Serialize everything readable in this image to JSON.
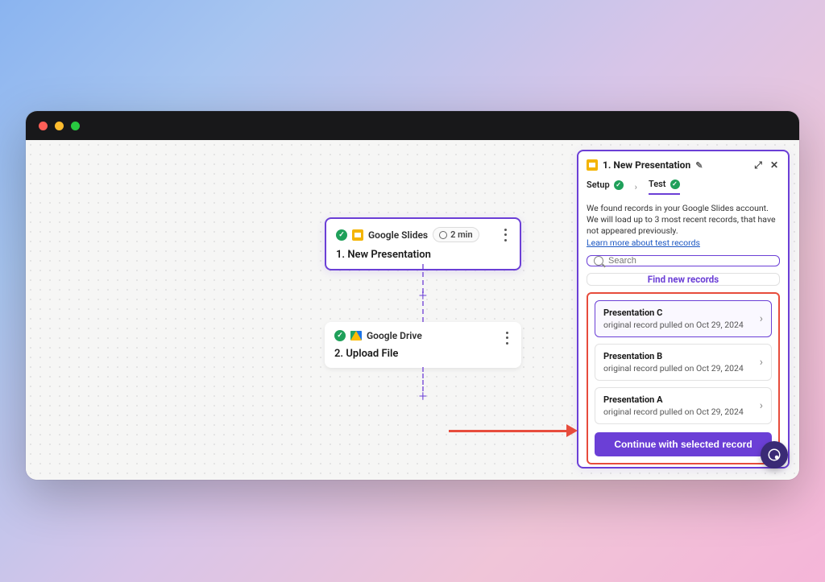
{
  "canvas": {
    "step1": {
      "app_label": "Google Slides",
      "time_label": "2 min",
      "title": "1. New Presentation"
    },
    "step2": {
      "app_label": "Google Drive",
      "title": "2. Upload File"
    }
  },
  "panel": {
    "header": {
      "title": "1. New Presentation"
    },
    "tabs": {
      "setup": "Setup",
      "test": "Test"
    },
    "info_text": "We found records in your Google Slides account. We will load up to 3 most recent records, that have not appeared previously.",
    "learn_more": "Learn more about test records",
    "search_placeholder": "Search",
    "find_button": "Find new records",
    "records": [
      {
        "name": "Presentation C",
        "subtitle": "original record pulled on Oct 29, 2024"
      },
      {
        "name": "Presentation B",
        "subtitle": "original record pulled on Oct 29, 2024"
      },
      {
        "name": "Presentation A",
        "subtitle": "original record pulled on Oct 29, 2024"
      }
    ],
    "continue_button": "Continue with selected record"
  }
}
